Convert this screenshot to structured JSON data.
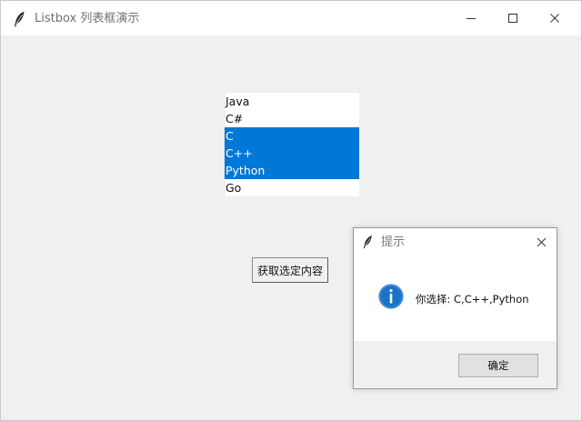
{
  "window": {
    "title": "Listbox 列表框演示",
    "controls": {
      "minimize": "minimize-icon",
      "maximize": "maximize-icon",
      "close": "close-icon"
    }
  },
  "listbox": {
    "items": [
      {
        "label": "Java",
        "selected": false
      },
      {
        "label": "C#",
        "selected": false
      },
      {
        "label": "C",
        "selected": true
      },
      {
        "label": "C++",
        "selected": true
      },
      {
        "label": "Python",
        "selected": true
      },
      {
        "label": "Go",
        "selected": false
      }
    ],
    "selection_color": "#0078d7"
  },
  "button": {
    "label": "获取选定内容"
  },
  "dialog": {
    "title": "提示",
    "message": "你选择: C,C++,Python",
    "icon": "info-icon",
    "ok_label": "确定",
    "icon_color": "#1a73c8"
  }
}
